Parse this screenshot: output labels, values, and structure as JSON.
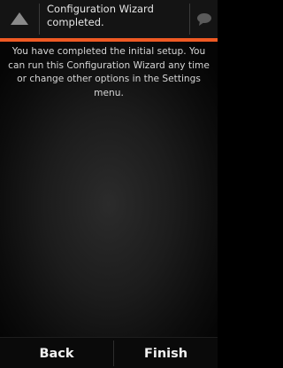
{
  "header": {
    "title": "Configuration Wizard completed.",
    "back_icon": "triangle-up-icon",
    "chat_icon": "speech-bubble-icon"
  },
  "accent_color": "#ef5a24",
  "message": "You have completed the initial setup. You can run this Configuration Wizard any time or change other options in the Settings menu.",
  "footer": {
    "back_label": "Back",
    "finish_label": "Finish"
  }
}
